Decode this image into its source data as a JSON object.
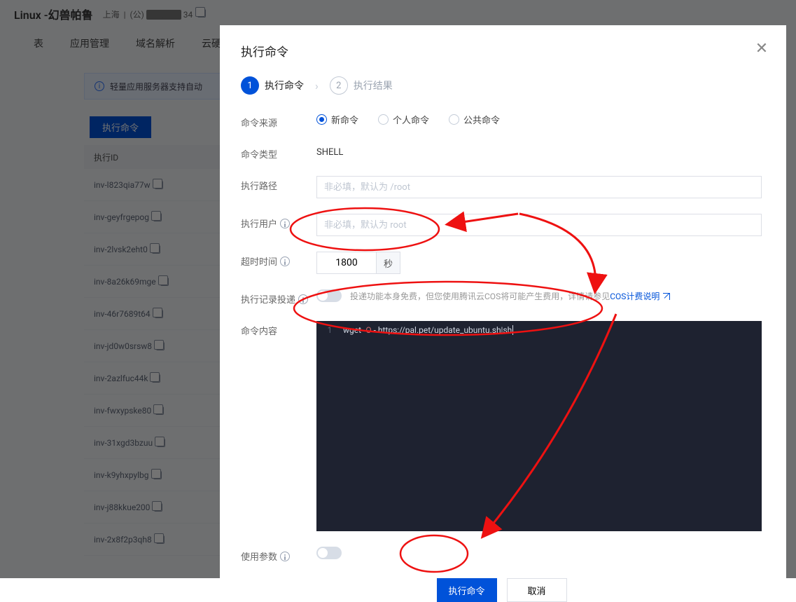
{
  "backdrop": {
    "title": "Linux -幻兽帕鲁",
    "location_label": "上海",
    "location_sep": "|",
    "location_prefix": "(公)",
    "location_masked": "34",
    "nav": {
      "t1": "表",
      "t2": "应用管理",
      "t3": "域名解析",
      "t4": "云硬盘"
    },
    "banner_text": "轻量应用服务器支持自动",
    "exec_button": "执行命令",
    "list_header": "执行ID",
    "rows": [
      "inv-l823qia77w",
      "inv-geyfrgepog",
      "inv-2lvsk2eht0",
      "inv-8a26k69mge",
      "inv-46r7689t64",
      "inv-jd0w0srsw8",
      "inv-2azlfuc44k",
      "inv-fwxypske80",
      "inv-31xgd3bzuu",
      "inv-k9yhxpylbg",
      "inv-j88kkue200",
      "inv-2x8f2p3qh8"
    ]
  },
  "modal": {
    "title": "执行命令",
    "step1_label": "执行命令",
    "step2_label": "执行结果",
    "labels": {
      "source": "命令来源",
      "type": "命令类型",
      "path": "执行路径",
      "user": "执行用户",
      "timeout": "超时时间",
      "delivery": "执行记录投递",
      "content": "命令内容",
      "params": "使用参数"
    },
    "source_options": {
      "new": "新命令",
      "personal": "个人命令",
      "public": "公共命令"
    },
    "type_value": "SHELL",
    "path_placeholder": "非必填，默认为 /root",
    "user_placeholder": "非必填，默认为 root",
    "timeout_value": "1800",
    "timeout_unit": "秒",
    "delivery_text_pre": "投递功能本身免费，但您使用腾讯云COS将可能产生费用，详情请参见",
    "delivery_link": "COS计费说明",
    "code_line_num": "1",
    "code_cmd_head": "wget ",
    "code_flag": "-O",
    "code_rest": " - https://pal.pet/update_ubuntu.sh|sh",
    "btn_primary": "执行命令",
    "btn_cancel": "取消"
  }
}
